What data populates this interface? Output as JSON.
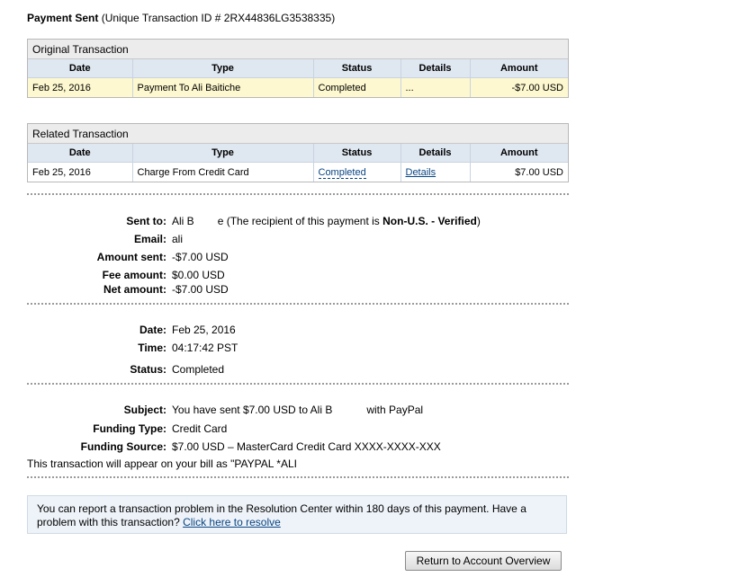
{
  "header": {
    "title": "Payment Sent",
    "subtitle": "(Unique Transaction ID # 2RX44836LG3538335)"
  },
  "original_transaction": {
    "title": "Original Transaction",
    "columns": [
      "Date",
      "Type",
      "Status",
      "Details",
      "Amount"
    ],
    "row": {
      "date": "Feb 25, 2016",
      "type": "Payment To Ali Baitiche",
      "status": "Completed",
      "details": "...",
      "amount": "-$7.00 USD"
    }
  },
  "related_transaction": {
    "title": "Related Transaction",
    "columns": [
      "Date",
      "Type",
      "Status",
      "Details",
      "Amount"
    ],
    "row": {
      "date": "Feb 25, 2016",
      "type": "Charge From Credit Card",
      "status": "Completed",
      "details": "Details",
      "amount": "$7.00 USD"
    }
  },
  "payment_details": {
    "sent_to_label": "Sent to:",
    "sent_to_name": "Ali B",
    "sent_to_name_end": "e",
    "recipient_note_prefix": "(The recipient of this payment is",
    "recipient_status": "Non-U.S. - Verified",
    "recipient_note_suffix": ")",
    "email_label": "Email:",
    "email_value": "ali",
    "amount_sent_label": "Amount sent:",
    "amount_sent_value": "-$7.00 USD",
    "fee_label": "Fee amount:",
    "fee_value": "$0.00 USD",
    "net_label": "Net amount:",
    "net_value": "-$7.00 USD"
  },
  "date_details": {
    "date_label": "Date:",
    "date_value": "Feb 25, 2016",
    "time_label": "Time:",
    "time_value": "04:17:42 PST",
    "status_label": "Status:",
    "status_value": "Completed"
  },
  "subject_details": {
    "subject_label": "Subject:",
    "subject_prefix": "You have sent $7.00 USD to Ali B",
    "subject_suffix": "with PayPal",
    "funding_type_label": "Funding Type:",
    "funding_type_value": "Credit Card",
    "funding_source_label": "Funding Source:",
    "funding_source_value": "$7.00 USD – MasterCard Credit Card XXXX-XXXX-XXX",
    "bill_note": "This transaction will appear on your bill as \"PAYPAL *ALI"
  },
  "notice": {
    "text": "You can report a transaction problem in the Resolution Center within 180 days of this payment. Have a problem with this transaction?",
    "link": "Click here to resolve"
  },
  "actions": {
    "return_button": "Return to Account Overview"
  }
}
